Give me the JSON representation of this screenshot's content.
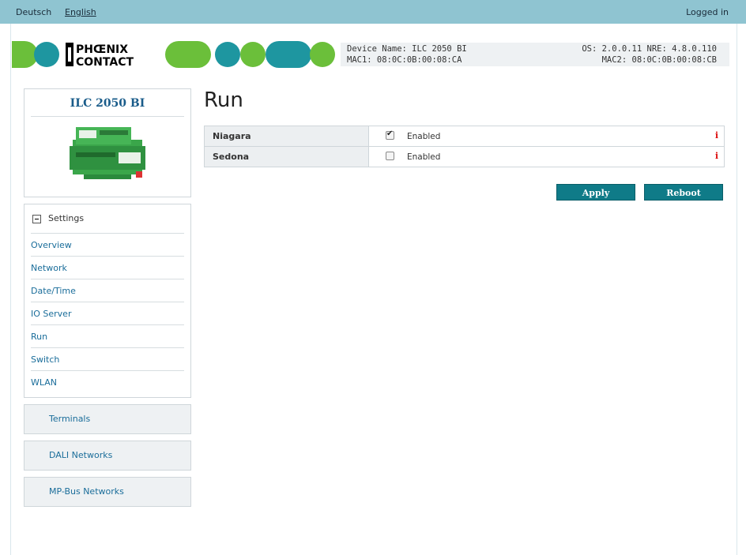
{
  "topbar": {
    "lang_de": "Deutsch",
    "lang_en": "English",
    "status": "Logged in"
  },
  "brand": {
    "logo_text": [
      "PHŒNIX",
      "CONTACT"
    ],
    "logo_colors": [
      "#6bbf3a",
      "#1e96a0",
      "#000000"
    ]
  },
  "device_info": {
    "name": "Device Name: ILC 2050 BI",
    "mac1": "MAC1: 08:0C:0B:00:08:CA",
    "os": "OS: 2.0.0.11 NRE: 4.8.0.110",
    "mac2": "MAC2: 08:0C:0B:00:08:CB"
  },
  "device_card": {
    "title": "ILC 2050 BI"
  },
  "nav": {
    "section_label": "Settings",
    "items": [
      "Overview",
      "Network",
      "Date/Time",
      "IO Server",
      "Run",
      "Switch",
      "WLAN"
    ]
  },
  "side_buttons": [
    "Terminals",
    "DALI Networks",
    "MP-Bus Networks"
  ],
  "page": {
    "title": "Run"
  },
  "services": [
    {
      "name": "Niagara",
      "enabled_label": "Enabled",
      "checked": true,
      "info": "i"
    },
    {
      "name": "Sedona",
      "enabled_label": "Enabled",
      "checked": false,
      "info": "i"
    }
  ],
  "actions": {
    "apply_label": "Apply",
    "reboot_label": "Reboot"
  },
  "colors": {
    "topbar": "#8fc4d1",
    "button": "#0f7b88",
    "link": "#1a6d9a",
    "title": "#1a5c8a"
  }
}
